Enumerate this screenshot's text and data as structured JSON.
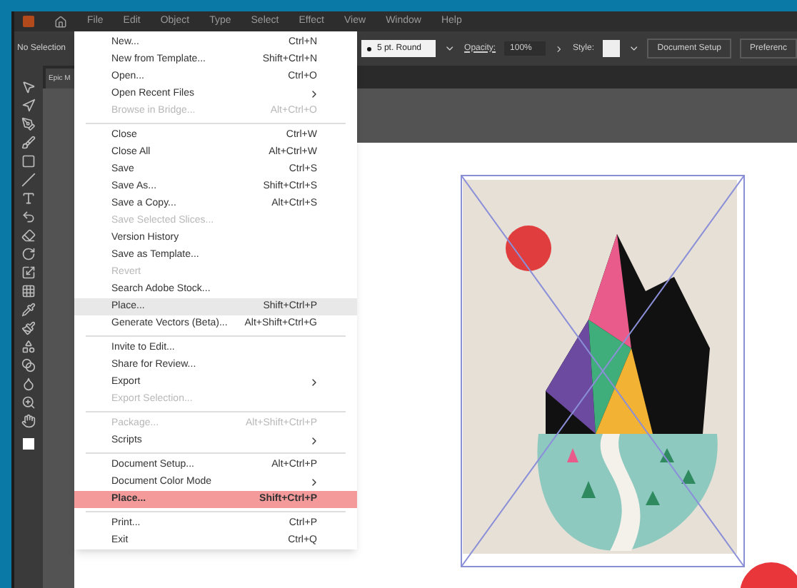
{
  "menu_bar": [
    "File",
    "Edit",
    "Object",
    "Type",
    "Select",
    "Effect",
    "View",
    "Window",
    "Help"
  ],
  "control_bar": {
    "selection": "No Selection",
    "stroke_profile": "5 pt. Round",
    "opacity_label": "Opacity:",
    "opacity_value": "100%",
    "style_label": "Style:",
    "buttons": [
      "Document Setup",
      "Preferenc"
    ]
  },
  "document_tab": "Epic M",
  "file_menu": [
    {
      "kind": "item",
      "label": "New...",
      "shortcut": "Ctrl+N",
      "disabled": false,
      "submenu": false,
      "hovered": false,
      "marked": false
    },
    {
      "kind": "item",
      "label": "New from Template...",
      "shortcut": "Shift+Ctrl+N",
      "disabled": false,
      "submenu": false,
      "hovered": false,
      "marked": false
    },
    {
      "kind": "item",
      "label": "Open...",
      "shortcut": "Ctrl+O",
      "disabled": false,
      "submenu": false,
      "hovered": false,
      "marked": false
    },
    {
      "kind": "item",
      "label": "Open Recent Files",
      "disabled": false,
      "submenu": true,
      "hovered": false,
      "marked": false
    },
    {
      "kind": "item",
      "label": "Browse in Bridge...",
      "shortcut": "Alt+Ctrl+O",
      "disabled": true,
      "submenu": false,
      "hovered": false,
      "marked": false
    },
    {
      "kind": "separator"
    },
    {
      "kind": "item",
      "label": "Close",
      "shortcut": "Ctrl+W",
      "disabled": false,
      "submenu": false,
      "hovered": false,
      "marked": false
    },
    {
      "kind": "item",
      "label": "Close All",
      "shortcut": "Alt+Ctrl+W",
      "disabled": false,
      "submenu": false,
      "hovered": false,
      "marked": false
    },
    {
      "kind": "item",
      "label": "Save",
      "shortcut": "Ctrl+S",
      "disabled": false,
      "submenu": false,
      "hovered": false,
      "marked": false
    },
    {
      "kind": "item",
      "label": "Save As...",
      "shortcut": "Shift+Ctrl+S",
      "disabled": false,
      "submenu": false,
      "hovered": false,
      "marked": false
    },
    {
      "kind": "item",
      "label": "Save a Copy...",
      "shortcut": "Alt+Ctrl+S",
      "disabled": false,
      "submenu": false,
      "hovered": false,
      "marked": false
    },
    {
      "kind": "item",
      "label": "Save Selected Slices...",
      "disabled": true,
      "submenu": false,
      "hovered": false,
      "marked": false
    },
    {
      "kind": "item",
      "label": "Version History",
      "disabled": false,
      "submenu": false,
      "hovered": false,
      "marked": false
    },
    {
      "kind": "item",
      "label": "Save as Template...",
      "disabled": false,
      "submenu": false,
      "hovered": false,
      "marked": false
    },
    {
      "kind": "item",
      "label": "Revert",
      "disabled": true,
      "submenu": false,
      "hovered": false,
      "marked": false
    },
    {
      "kind": "item",
      "label": "Search Adobe Stock...",
      "disabled": false,
      "submenu": false,
      "hovered": false,
      "marked": false
    },
    {
      "kind": "item",
      "label": "Place...",
      "shortcut": "Shift+Ctrl+P",
      "disabled": false,
      "submenu": false,
      "hovered": true,
      "marked": false
    },
    {
      "kind": "item",
      "label": "Generate Vectors (Beta)...",
      "shortcut": "Alt+Shift+Ctrl+G",
      "disabled": false,
      "submenu": false,
      "hovered": false,
      "marked": false
    },
    {
      "kind": "separator"
    },
    {
      "kind": "item",
      "label": "Invite to Edit...",
      "disabled": false,
      "submenu": false,
      "hovered": false,
      "marked": false
    },
    {
      "kind": "item",
      "label": "Share for Review...",
      "disabled": false,
      "submenu": false,
      "hovered": false,
      "marked": false
    },
    {
      "kind": "item",
      "label": "Export",
      "disabled": false,
      "submenu": true,
      "hovered": false,
      "marked": false
    },
    {
      "kind": "item",
      "label": "Export Selection...",
      "disabled": true,
      "submenu": false,
      "hovered": false,
      "marked": false
    },
    {
      "kind": "separator"
    },
    {
      "kind": "item",
      "label": "Package...",
      "shortcut": "Alt+Shift+Ctrl+P",
      "disabled": true,
      "submenu": false,
      "hovered": false,
      "marked": false
    },
    {
      "kind": "item",
      "label": "Scripts",
      "disabled": false,
      "submenu": true,
      "hovered": false,
      "marked": false
    },
    {
      "kind": "separator"
    },
    {
      "kind": "item",
      "label": "Document Setup...",
      "shortcut": "Alt+Ctrl+P",
      "disabled": false,
      "submenu": false,
      "hovered": false,
      "marked": false
    },
    {
      "kind": "item",
      "label": "Document Color Mode",
      "disabled": false,
      "submenu": true,
      "hovered": false,
      "marked": false
    },
    {
      "kind": "item",
      "label": "Place...",
      "shortcut": "Shift+Ctrl+P",
      "disabled": false,
      "submenu": false,
      "hovered": false,
      "marked": true
    },
    {
      "kind": "separator"
    },
    {
      "kind": "item",
      "label": "Print...",
      "shortcut": "Ctrl+P",
      "disabled": false,
      "submenu": false,
      "hovered": false,
      "marked": false
    },
    {
      "kind": "item",
      "label": "Exit",
      "shortcut": "Ctrl+Q",
      "disabled": false,
      "submenu": false,
      "hovered": false,
      "marked": false
    }
  ]
}
